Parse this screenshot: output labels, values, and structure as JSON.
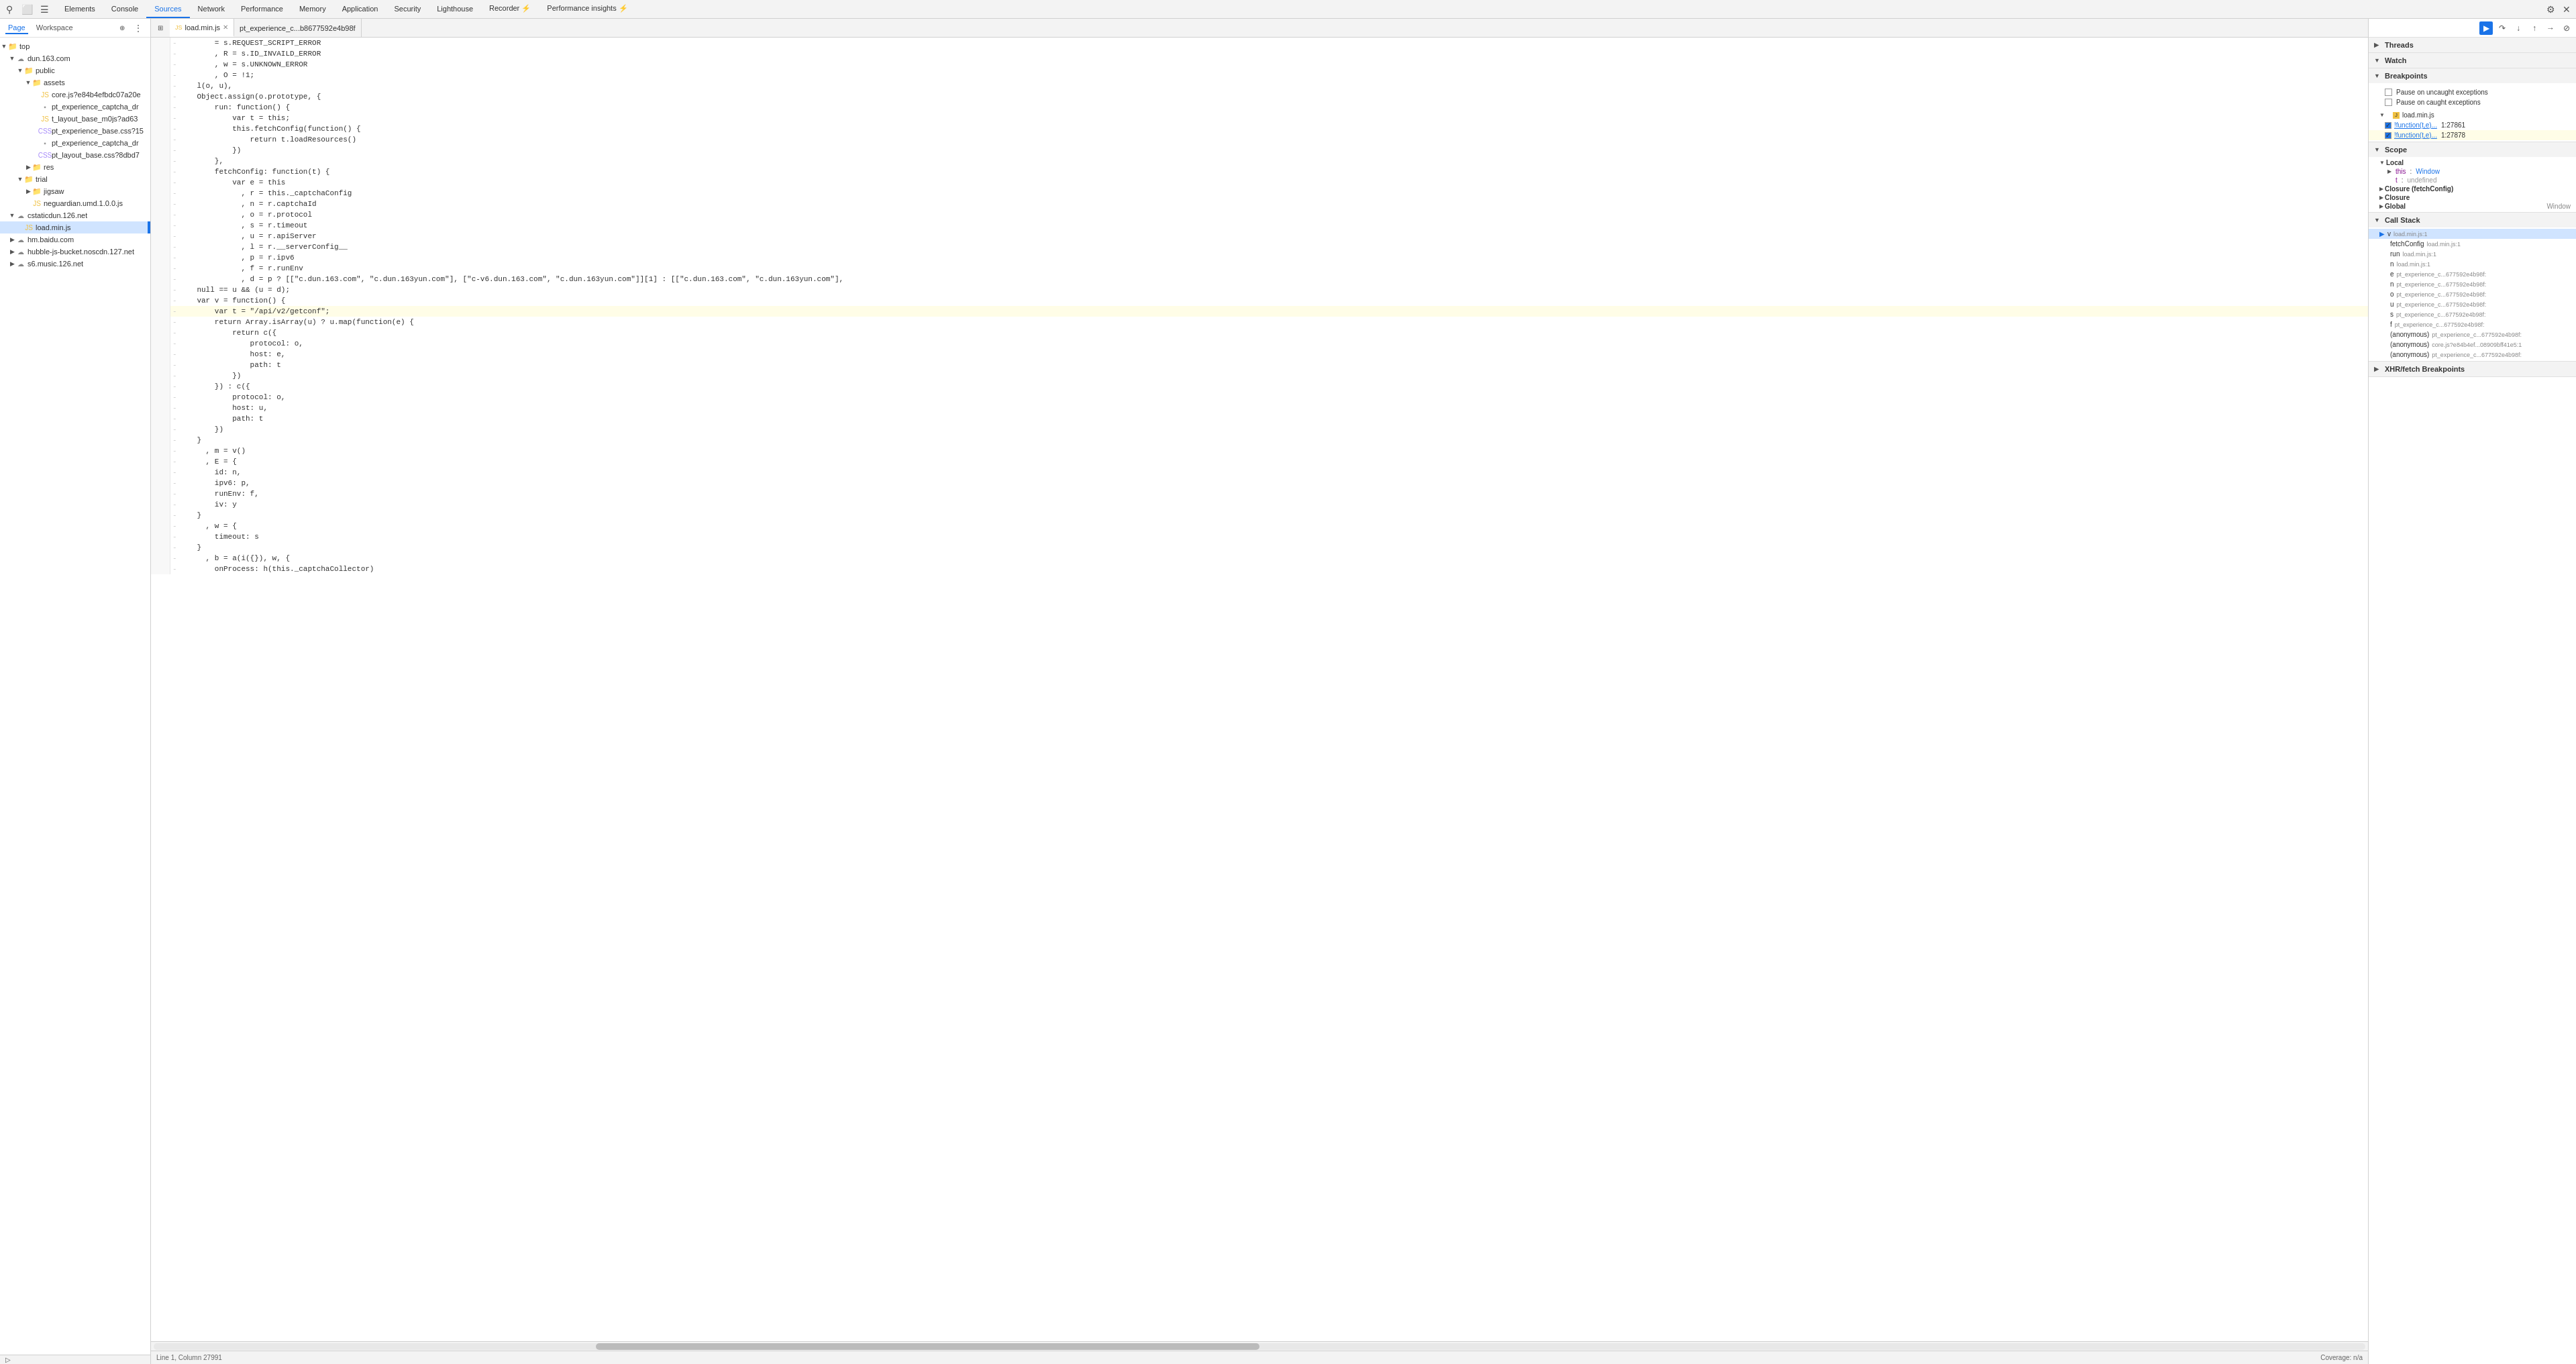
{
  "toolbar": {
    "icons": [
      "☰",
      "◻",
      "⚙"
    ],
    "tabs": [
      {
        "label": "Elements",
        "active": false
      },
      {
        "label": "Console",
        "active": false
      },
      {
        "label": "Sources",
        "active": true
      },
      {
        "label": "Network",
        "active": false
      },
      {
        "label": "Performance",
        "active": false
      },
      {
        "label": "Memory",
        "active": false
      },
      {
        "label": "Application",
        "active": false
      },
      {
        "label": "Security",
        "active": false
      },
      {
        "label": "Lighthouse",
        "active": false
      },
      {
        "label": "Recorder ⚡",
        "active": false
      },
      {
        "label": "Performance insights ⚡",
        "active": false
      }
    ]
  },
  "sidebar": {
    "tabs": [
      {
        "label": "Page",
        "active": true
      },
      {
        "label": "Workspace",
        "active": false
      }
    ],
    "tree": [
      {
        "id": "top",
        "label": "top",
        "indent": 0,
        "type": "folder",
        "expanded": true,
        "icon": "folder"
      },
      {
        "id": "dun163",
        "label": "dun.163.com",
        "indent": 1,
        "type": "domain",
        "expanded": true,
        "icon": "cloud"
      },
      {
        "id": "public",
        "label": "public",
        "indent": 2,
        "type": "folder",
        "expanded": true,
        "icon": "folder"
      },
      {
        "id": "assets",
        "label": "assets",
        "indent": 3,
        "type": "folder",
        "expanded": true,
        "icon": "folder"
      },
      {
        "id": "core-js",
        "label": "core.js?e84b4efbdc07a20e",
        "indent": 4,
        "type": "js",
        "icon": "js"
      },
      {
        "id": "pt-exp",
        "label": "pt_experience_captcha_dr",
        "indent": 4,
        "type": "file",
        "icon": "file"
      },
      {
        "id": "t-layout",
        "label": "t_layout_base_m0js?ad63",
        "indent": 4,
        "type": "js",
        "icon": "js"
      },
      {
        "id": "pt-exp2",
        "label": "pt_experience_base.css?15",
        "indent": 4,
        "type": "css",
        "icon": "css"
      },
      {
        "id": "pt-exp3",
        "label": "pt_experience_captcha_dr",
        "indent": 4,
        "type": "file",
        "icon": "file"
      },
      {
        "id": "pt-layout2",
        "label": "pt_layout_base.css?8dbd7",
        "indent": 4,
        "type": "css",
        "icon": "css"
      },
      {
        "id": "res",
        "label": "res",
        "indent": 3,
        "type": "folder",
        "expanded": false,
        "icon": "folder"
      },
      {
        "id": "trial",
        "label": "trial",
        "indent": 2,
        "type": "folder",
        "expanded": true,
        "icon": "folder"
      },
      {
        "id": "jigsaw",
        "label": "jigsaw",
        "indent": 3,
        "type": "folder",
        "expanded": false,
        "icon": "folder"
      },
      {
        "id": "neguardian",
        "label": "neguardian.umd.1.0.0.js",
        "indent": 3,
        "type": "js",
        "icon": "js"
      },
      {
        "id": "cstaticDun",
        "label": "cstaticdun.126.net",
        "indent": 1,
        "type": "domain",
        "expanded": true,
        "icon": "cloud"
      },
      {
        "id": "loadminjs",
        "label": "load.min.js",
        "indent": 2,
        "type": "js",
        "icon": "js",
        "selected": true
      },
      {
        "id": "hmBaidu",
        "label": "hm.baidu.com",
        "indent": 1,
        "type": "domain",
        "expanded": false,
        "icon": "cloud"
      },
      {
        "id": "hubble",
        "label": "hubble-js-bucket.noscdn.127.net",
        "indent": 1,
        "type": "domain",
        "expanded": false,
        "icon": "cloud"
      },
      {
        "id": "s6music",
        "label": "s6.music.126.net",
        "indent": 1,
        "type": "domain",
        "expanded": false,
        "icon": "cloud"
      }
    ]
  },
  "editor": {
    "tabs": [
      {
        "label": "load.min.js",
        "active": true,
        "closeable": true
      },
      {
        "label": "pt_experience_c...b8677592e4b98f",
        "active": false,
        "closeable": false
      }
    ],
    "code_lines": [
      {
        "num": "",
        "bp": "-",
        "code": "        = s.REQUEST_SCRIPT_ERROR"
      },
      {
        "num": "",
        "bp": "-",
        "code": "        , R = s.ID_INVAILD_ERROR"
      },
      {
        "num": "",
        "bp": "-",
        "code": "        , w = s.UNKNOWN_ERROR"
      },
      {
        "num": "",
        "bp": "-",
        "code": "        , O = !1;"
      },
      {
        "num": "",
        "bp": "-",
        "code": "    l(o, u),"
      },
      {
        "num": "",
        "bp": "-",
        "code": "    Object.assign(o.prototype, {"
      },
      {
        "num": "",
        "bp": "-",
        "code": "        run: function() {"
      },
      {
        "num": "",
        "bp": "-",
        "code": "            var t = this;"
      },
      {
        "num": "",
        "bp": "-",
        "code": "            this.fetchConfig(function() {"
      },
      {
        "num": "",
        "bp": "-",
        "code": "                return t.loadResources()"
      },
      {
        "num": "",
        "bp": "-",
        "code": "            })"
      },
      {
        "num": "",
        "bp": "-",
        "code": "        },"
      },
      {
        "num": "",
        "bp": "-",
        "code": "        fetchConfig: function(t) {"
      },
      {
        "num": "",
        "bp": "-",
        "code": "            var e = this"
      },
      {
        "num": "",
        "bp": "-",
        "code": "              , r = this._captchaConfig"
      },
      {
        "num": "",
        "bp": "-",
        "code": "              , n = r.captchaId"
      },
      {
        "num": "",
        "bp": "-",
        "code": "              , o = r.protocol"
      },
      {
        "num": "",
        "bp": "-",
        "code": "              , s = r.timeout"
      },
      {
        "num": "",
        "bp": "-",
        "code": "              , u = r.apiServer"
      },
      {
        "num": "",
        "bp": "-",
        "code": "              , l = r.__serverConfig__"
      },
      {
        "num": "",
        "bp": "-",
        "code": "              , p = r.ipv6"
      },
      {
        "num": "",
        "bp": "-",
        "code": "              , f = r.runEnv"
      },
      {
        "num": "",
        "bp": "-",
        "code": "              , d = p ? [[\"c.dun.163.com\", \"c.dun.163yun.com\"], [\"c-v6.dun.163.com\", \"c.dun.163yun.com\"]][1] : [[\"c.dun.163.com\", \"c.dun.163yun.com\"],"
      },
      {
        "num": "",
        "bp": "-",
        "code": "    null == u && (u = d);"
      },
      {
        "num": "",
        "bp": "-",
        "code": "    var v = function() {"
      },
      {
        "num": "",
        "bp": "-",
        "code": "        var t = \"/api/v2/getconf\";",
        "highlighted": true
      },
      {
        "num": "",
        "bp": "-",
        "code": "        return Array.isArray(u) ? u.map(function(e) {"
      },
      {
        "num": "",
        "bp": "-",
        "code": "            return c({"
      },
      {
        "num": "",
        "bp": "-",
        "code": "                protocol: o,"
      },
      {
        "num": "",
        "bp": "-",
        "code": "                host: e,"
      },
      {
        "num": "",
        "bp": "-",
        "code": "                path: t"
      },
      {
        "num": "",
        "bp": "-",
        "code": "            })"
      },
      {
        "num": "",
        "bp": "-",
        "code": "        }) : c({"
      },
      {
        "num": "",
        "bp": "-",
        "code": "            protocol: o,"
      },
      {
        "num": "",
        "bp": "-",
        "code": "            host: u,"
      },
      {
        "num": "",
        "bp": "-",
        "code": "            path: t"
      },
      {
        "num": "",
        "bp": "-",
        "code": "        })"
      },
      {
        "num": "",
        "bp": "-",
        "code": "    }"
      },
      {
        "num": "",
        "bp": "-",
        "code": "      , m = v()"
      },
      {
        "num": "",
        "bp": "-",
        "code": "      , E = {"
      },
      {
        "num": "",
        "bp": "-",
        "code": "        id: n,"
      },
      {
        "num": "",
        "bp": "-",
        "code": "        ipv6: p,"
      },
      {
        "num": "",
        "bp": "-",
        "code": "        runEnv: f,"
      },
      {
        "num": "",
        "bp": "-",
        "code": "        iv: y"
      },
      {
        "num": "",
        "bp": "-",
        "code": "    }"
      },
      {
        "num": "",
        "bp": "-",
        "code": "      , w = {"
      },
      {
        "num": "",
        "bp": "-",
        "code": "        timeout: s"
      },
      {
        "num": "",
        "bp": "-",
        "code": "    }"
      },
      {
        "num": "",
        "bp": "-",
        "code": "      , b = a(i({}), w, {"
      },
      {
        "num": "",
        "bp": "-",
        "code": "        onProcess: h(this._captchaCollector)"
      }
    ],
    "statusbar": {
      "position": "Line 1, Column 27991",
      "coverage": "Coverage: n/a"
    }
  },
  "right_panel": {
    "sections": [
      {
        "id": "threads",
        "label": "Threads",
        "expanded": false
      },
      {
        "id": "watch",
        "label": "Watch",
        "expanded": false
      },
      {
        "id": "breakpoints",
        "label": "Breakpoints",
        "expanded": true,
        "pause_uncaught": "Pause on uncaught exceptions",
        "pause_caught": "Pause on caught exceptions",
        "bp_file": "load.min.js",
        "bp_items": [
          {
            "checked": true,
            "fn": "!function(t,e)...",
            "line": "1:27861"
          },
          {
            "checked": true,
            "fn": "!function(t,e)...",
            "line": "1:27878",
            "highlighted": true
          }
        ]
      },
      {
        "id": "scope",
        "label": "Scope",
        "expanded": true,
        "subsections": [
          {
            "label": "Local",
            "expanded": true,
            "items": [
              {
                "key": "this",
                "value": "Window",
                "expandable": true
              },
              {
                "key": "t",
                "value": "undefined",
                "expandable": false
              }
            ]
          },
          {
            "label": "Closure (fetchConfig)",
            "expanded": false
          },
          {
            "label": "Closure",
            "expanded": false
          },
          {
            "label": "Global",
            "value": "Window",
            "expanded": false
          }
        ]
      },
      {
        "id": "callstack",
        "label": "Call Stack",
        "expanded": true,
        "items": [
          {
            "fn": "v",
            "file": "load.min.js:1",
            "active": true
          },
          {
            "fn": "fetchConfig",
            "file": "load.min.js:1",
            "active": false
          },
          {
            "fn": "run",
            "file": "load.min.js:1",
            "active": false
          },
          {
            "fn": "n",
            "file": "load.min.js:1",
            "active": false
          },
          {
            "fn": "e",
            "file": "pt_experience_c...677592e4b98f:",
            "active": false
          },
          {
            "fn": "n",
            "file": "pt_experience_c...677592e4b98f:",
            "active": false
          },
          {
            "fn": "o",
            "file": "pt_experience_c...677592e4b98f:",
            "active": false
          },
          {
            "fn": "u",
            "file": "pt_experience_c...677592e4b98f:",
            "active": false
          },
          {
            "fn": "s",
            "file": "pt_experience_c...677592e4b98f:",
            "active": false
          },
          {
            "fn": "f",
            "file": "pt_experience_c...677592e4b98f:",
            "active": false
          },
          {
            "fn": "(anonymous)",
            "file": "pt_experience_c...677592e4b98f:",
            "active": false
          },
          {
            "fn": "(anonymous)",
            "file": "core.js?e84b4ef...08909bff41e5:1",
            "active": false
          },
          {
            "fn": "(anonymous)",
            "file": "pt_experience_c...677592e4b98f:",
            "active": false
          }
        ]
      },
      {
        "id": "xhrfetch",
        "label": "XHR/fetch Breakpoints",
        "expanded": false
      }
    ]
  }
}
